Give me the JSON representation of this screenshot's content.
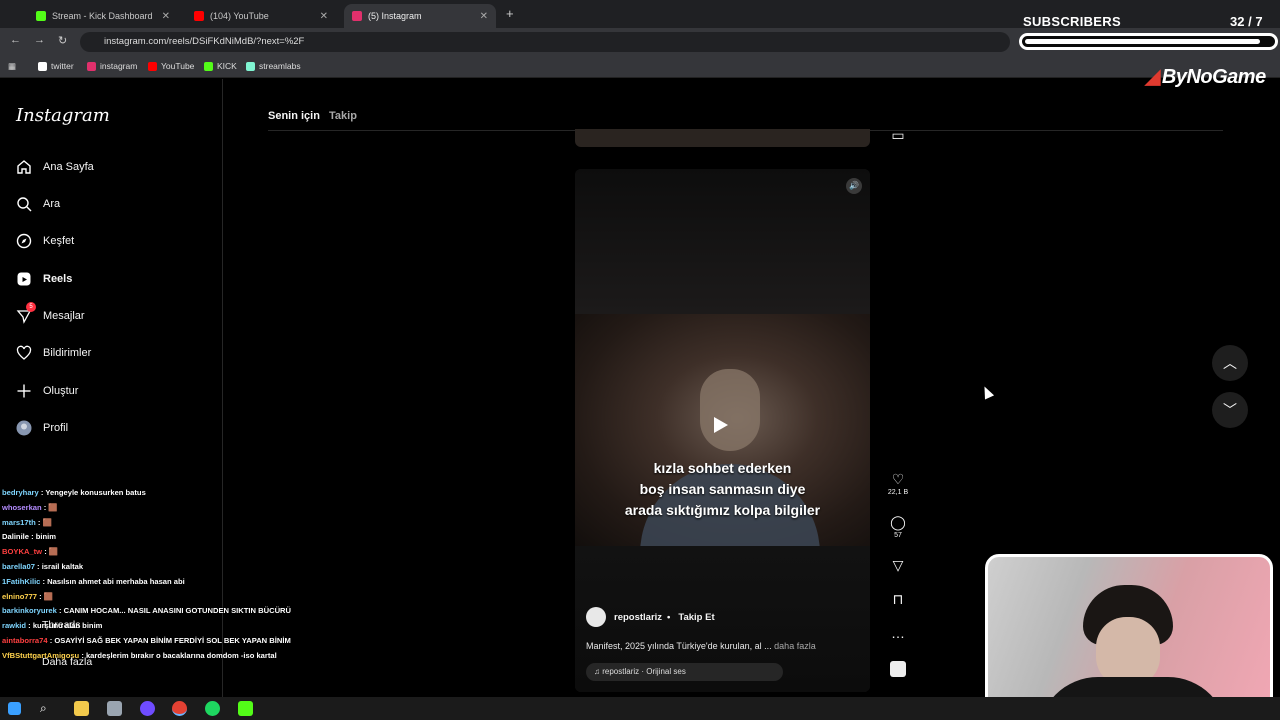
{
  "browser": {
    "tabs": [
      {
        "label": "Stream - Kick Dashboard",
        "color": "#53fc18"
      },
      {
        "label": "(104) YouTube",
        "color": "#ff0000"
      },
      {
        "label": "(5) Instagram",
        "color": "#e1306c"
      }
    ],
    "url": "instagram.com/reels/DSiFKdNiMdB/?next=%2F",
    "bookmarks": [
      {
        "label": "twitter",
        "color": "#000000"
      },
      {
        "label": "instagram",
        "color": "#e1306c"
      },
      {
        "label": "YouTube",
        "color": "#ff0000"
      },
      {
        "label": "KICK",
        "color": "#53fc18"
      },
      {
        "label": "streamlabs",
        "color": "#80f5d2"
      }
    ]
  },
  "instagram": {
    "logo": "Instagram",
    "nav": [
      {
        "label": "Ana Sayfa",
        "icon": "home-icon"
      },
      {
        "label": "Ara",
        "icon": "search-icon"
      },
      {
        "label": "Keşfet",
        "icon": "compass-icon"
      },
      {
        "label": "Reels",
        "icon": "reels-icon"
      },
      {
        "label": "Mesajlar",
        "icon": "messenger-icon",
        "badge": "5"
      },
      {
        "label": "Bildirimler",
        "icon": "heart-icon"
      },
      {
        "label": "Oluştur",
        "icon": "plus-icon"
      },
      {
        "label": "Profil",
        "icon": "avatar-icon"
      }
    ],
    "more_nav": [
      "Threads",
      "Daha fazla"
    ],
    "feed_tabs": [
      "Senin için",
      "Takip"
    ],
    "reel": {
      "caption_lines": [
        "kızla sohbet ederken",
        "boş insan sanmasın diye",
        "arada sıktığımız kolpa bilgiler"
      ],
      "author": "repostlariz",
      "separator": "•",
      "follow_label": "Takip Et",
      "description": "Manifest, 2025 yılında Türkiye'de kurulan, al ...",
      "more_label": "daha fazla",
      "audio": "repostlariz · Orijinal ses"
    },
    "actions": {
      "likes": "22,1 B",
      "comments": "57"
    }
  },
  "chat": [
    {
      "user": "bedryhary",
      "user_color": "#7fd6ff",
      "msg": "Yengeyle konusurken batus"
    },
    {
      "user": "whoserkan",
      "user_color": "#b48cff",
      "msg": "🟫"
    },
    {
      "user": "mars17th",
      "user_color": "#7fd6ff",
      "msg": "🟫"
    },
    {
      "user": "Dalinile",
      "user_color": "#ffffff",
      "msg": "binim"
    },
    {
      "user": "BOYKA_tw",
      "user_color": "#ff4040",
      "msg": "🟫"
    },
    {
      "user": "barella07",
      "user_color": "#7fd6ff",
      "msg": "israil kaltak"
    },
    {
      "user": "1FatihKilic",
      "user_color": "#7fd6ff",
      "msg": "Nasılsın ahmet abi merhaba hasan abi"
    },
    {
      "user": "elnino777",
      "user_color": "#ffd24d",
      "msg": "🟫"
    },
    {
      "user": "barkinkoryurek",
      "user_color": "#7fd6ff",
      "msg": "CANIM HOCAM... NASIL ANASINI GOTUNDEN SIKTIN BÜCÜRÜ"
    },
    {
      "user": "rawkid",
      "user_color": "#7fd6ff",
      "msg": "kurşunu alan binim"
    },
    {
      "user": "aintaborra74",
      "user_color": "#ff4040",
      "msg": "OSAYİYİ SAĞ BEK YAPAN BİNİM FERDİYİ SOL BEK YAPAN BİNİM"
    },
    {
      "user": "VfBStuttgartAmigosu",
      "user_color": "#ffd24d",
      "msg": "kardeşlerim bırakır o bacaklarına domdom -iso kartal"
    }
  ],
  "stream": {
    "subs_label": "SUBSCRIBERS",
    "subs_count": "32",
    "subs_goal": "/ 7",
    "subs_progress": 0.95,
    "brand": "ByNoGame"
  }
}
